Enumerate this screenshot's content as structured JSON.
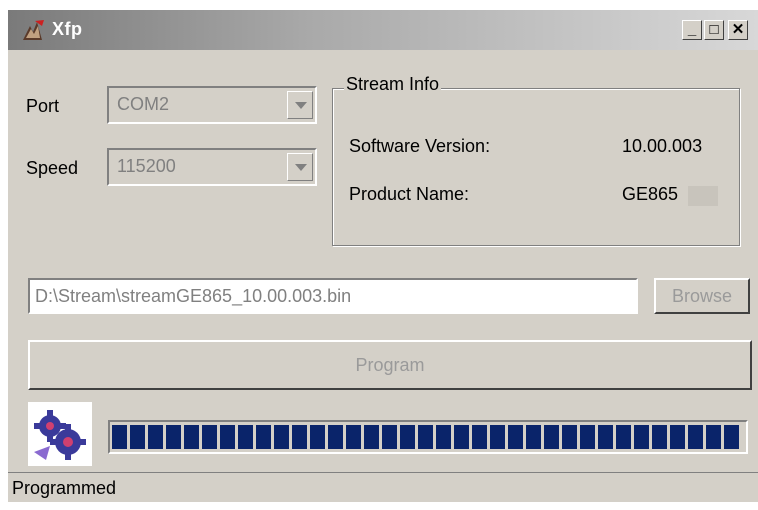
{
  "window": {
    "title": "Xfp",
    "icon": "xfp-app-icon",
    "controls": {
      "minimize": "_",
      "maximize": "□",
      "close": "✕"
    }
  },
  "port": {
    "label": "Port",
    "value": "COM2"
  },
  "speed": {
    "label": "Speed",
    "value": "115200"
  },
  "stream_info": {
    "title": "Stream Info",
    "software_version_label": "Software Version:",
    "software_version_value": "10.00.003",
    "product_name_label": "Product Name:",
    "product_name_value": "GE865"
  },
  "file": {
    "path": "D:\\Stream\\streamGE865_10.00.003.bin",
    "browse_label": "Browse"
  },
  "program_label": "Program",
  "progress": {
    "value": 1.0,
    "color": "#0a246a"
  },
  "status": "Programmed",
  "colors": {
    "face": "#d4d0c8",
    "progress_block": "#0a246a"
  }
}
